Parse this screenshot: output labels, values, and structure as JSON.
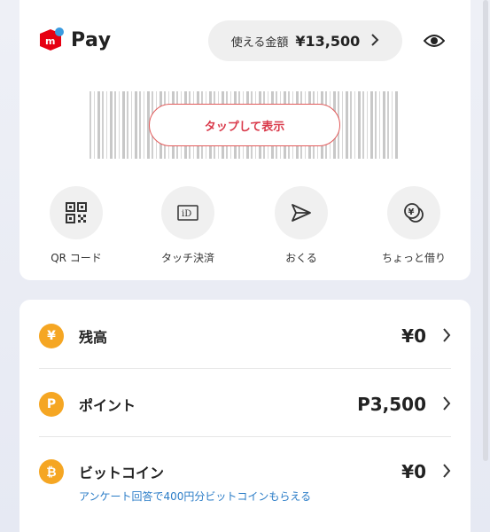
{
  "header": {
    "logo_text": "Pay",
    "balance_label": "使える金額",
    "balance_amount": "¥13,500",
    "balance_chevron": "›",
    "eye_icon": "eye-icon"
  },
  "barcode": {
    "tap_label": "タップして表示"
  },
  "actions": [
    {
      "label": "QR コード",
      "icon": "qr-code-icon"
    },
    {
      "label": "タッチ決済",
      "icon": "id-card-icon"
    },
    {
      "label": "おくる",
      "icon": "send-icon"
    },
    {
      "label": "ちょっと借り",
      "icon": "yen-coins-icon"
    }
  ],
  "rows": [
    {
      "icon_char": "¥",
      "label": "残高",
      "value": "¥0",
      "color": "#f5a623"
    },
    {
      "icon_char": "P",
      "label": "ポイント",
      "value": "P3,500",
      "color": "#f5a623"
    },
    {
      "icon_char": "₿",
      "label": "ビットコイン",
      "value": "¥0",
      "sub": "アンケート回答で400円分ビットコインもらえる",
      "color": "#f5a623"
    }
  ],
  "colors": {
    "brand_red": "#e60012",
    "tap_red": "#d9394a",
    "accent_yellow": "#f5a623",
    "link_blue": "#2a7cc7"
  }
}
